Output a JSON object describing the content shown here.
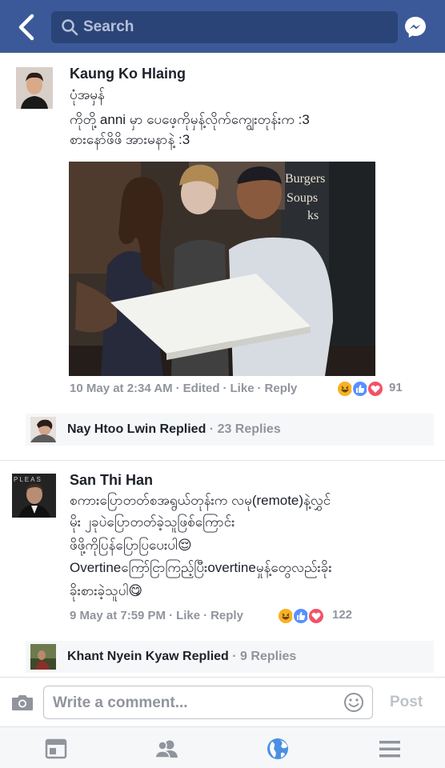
{
  "header": {
    "search_placeholder": "Search",
    "back_icon": "back-chevron-icon",
    "messenger_icon": "messenger-icon"
  },
  "comments": [
    {
      "author": "Kaung Ko Hlaing",
      "lines": [
        "ပုံအမှန်",
        "ကိုတို့ anni မှာ     ပေဖေ့ကိုမှန့်လိုက်ကျွေးတုန်းက :3",
        "စားနော်ဖိဖိ အားမနာနဲ့ :3"
      ],
      "timestamp": "10 May at 2:34 AM",
      "edited": "Edited",
      "like": "Like",
      "reply": "Reply",
      "reaction_count": "91",
      "replies": {
        "name": "Nay Htoo Lwin Replied",
        "count": "23 Replies"
      }
    },
    {
      "author": "San Thi Han",
      "lines": [
        "စကားပြောတတ်စအရွယ်တုန်းက လမု(remote)နဲ့လွှင်",
        "မိုး ၂ခုပဲပြောတတ်ခဲ့သူဖြစ်ကြောင်း",
        "ဖိဖို့ကိုပြန်ပြောပြပေးပါ😌",
        "Overtineကြော်ငြာကြည့်ပြီးovertineမှုန့်တွေလည်းခိုး",
        "ခိုးစားခဲ့သူပါ😋"
      ],
      "timestamp": "9 May at 7:59 PM",
      "like": "Like",
      "reply": "Reply",
      "reaction_count": "122",
      "replies": {
        "name": "Khant Nyein Kyaw Replied",
        "count": "9 Replies"
      }
    }
  ],
  "photo": {
    "sign_lines": [
      "Burgers",
      "Soups",
      "ks"
    ]
  },
  "composer": {
    "placeholder": "Write a comment...",
    "post_label": "Post"
  },
  "nav": {
    "items": [
      "news-feed-icon",
      "friends-icon",
      "globe-icon",
      "menu-icon"
    ]
  },
  "colors": {
    "brand": "#3b5998",
    "meta": "#90949c",
    "haha": "#f7b125",
    "like": "#5890ff",
    "love": "#f25268"
  }
}
